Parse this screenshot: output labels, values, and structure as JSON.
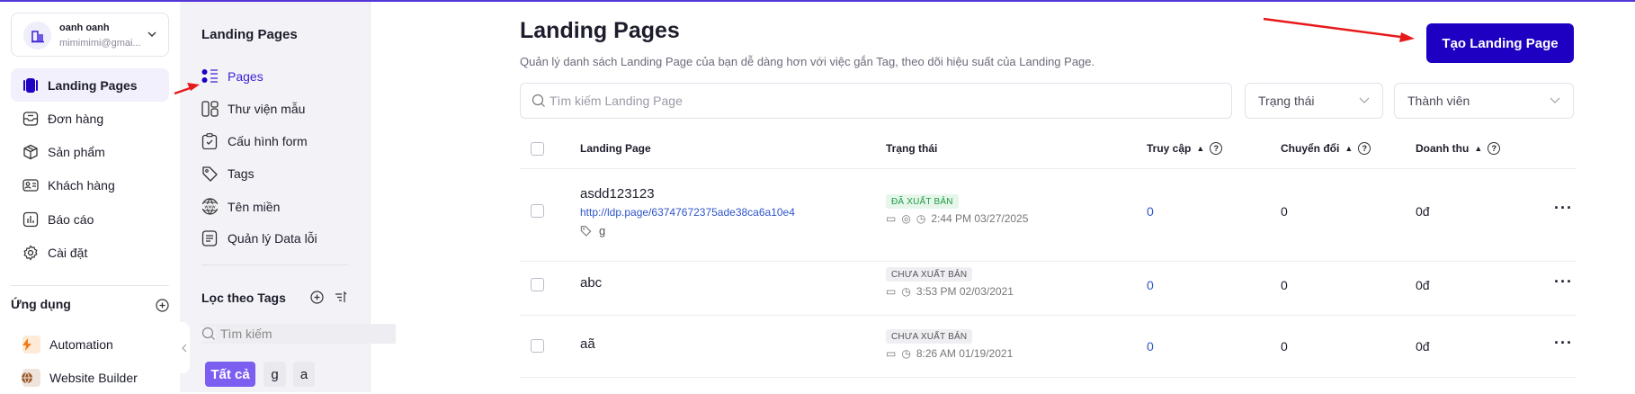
{
  "account": {
    "name": "oanh oanh",
    "email": "mimimimi@gmai..."
  },
  "nav": [
    {
      "label": "Landing Pages",
      "icon": "landing-pages-icon",
      "active": true
    },
    {
      "label": "Đơn hàng",
      "icon": "orders-icon"
    },
    {
      "label": "Sản phẩm",
      "icon": "product-box-icon"
    },
    {
      "label": "Khách hàng",
      "icon": "customer-card-icon"
    },
    {
      "label": "Báo cáo",
      "icon": "report-chart-icon"
    },
    {
      "label": "Cài đặt",
      "icon": "gear-icon"
    }
  ],
  "apps": {
    "title": "Ứng dụng",
    "items": [
      {
        "label": "Automation",
        "icon": "lightning-icon"
      },
      {
        "label": "Website Builder",
        "icon": "globe-icon"
      }
    ]
  },
  "subnav": {
    "title": "Landing Pages",
    "items": [
      {
        "label": "Pages",
        "icon": "list-icon",
        "active": true
      },
      {
        "label": "Thư viện mẫu",
        "icon": "template-library-icon"
      },
      {
        "label": "Cấu hình form",
        "icon": "clipboard-check-icon"
      },
      {
        "label": "Tags",
        "icon": "tag-icon"
      },
      {
        "label": "Tên miền",
        "icon": "www-globe-icon"
      },
      {
        "label": "Quản lý Data lỗi",
        "icon": "document-icon"
      }
    ]
  },
  "tag_filter": {
    "title": "Lọc theo Tags",
    "search_placeholder": "Tìm kiếm",
    "chips": [
      "Tất cả",
      "g",
      "a"
    ]
  },
  "main": {
    "title": "Landing Pages",
    "subtitle": "Quản lý danh sách Landing Page của bạn dễ dàng hơn với việc gắn Tag, theo dõi hiệu suất của Landing Page.",
    "create_button": "Tạo Landing Page",
    "search_placeholder": "Tìm kiếm Landing Page",
    "filter_status": "Trạng thái",
    "filter_member": "Thành viên",
    "columns": [
      "Landing Page",
      "Trạng thái",
      "Truy cập",
      "Chuyển đổi",
      "Doanh thu"
    ],
    "rows": [
      {
        "name": "asdd123123",
        "url": "http://ldp.page/63747672375ade38ca6a10e4",
        "tag": "g",
        "status": "ĐÃ XUẤT BẢN",
        "time": "2:44 PM 03/27/2025",
        "visits": "0",
        "conversions": "0",
        "revenue": "0đ"
      },
      {
        "name": "abc",
        "status": "CHƯA XUẤT BẢN",
        "time": "3:53 PM 02/03/2021",
        "visits": "0",
        "conversions": "0",
        "revenue": "0đ"
      },
      {
        "name": "aã",
        "status": "CHƯA XUẤT BẢN",
        "time": "8:26 AM 01/19/2021",
        "visits": "0",
        "conversions": "0",
        "revenue": "0đ"
      }
    ]
  },
  "colors": {
    "accent": "#1d00c1",
    "topbar": "#5537d8",
    "active_nav": "#f1f0fc",
    "published": "#1f9c45",
    "annotation_arrow": "#e8191a"
  }
}
